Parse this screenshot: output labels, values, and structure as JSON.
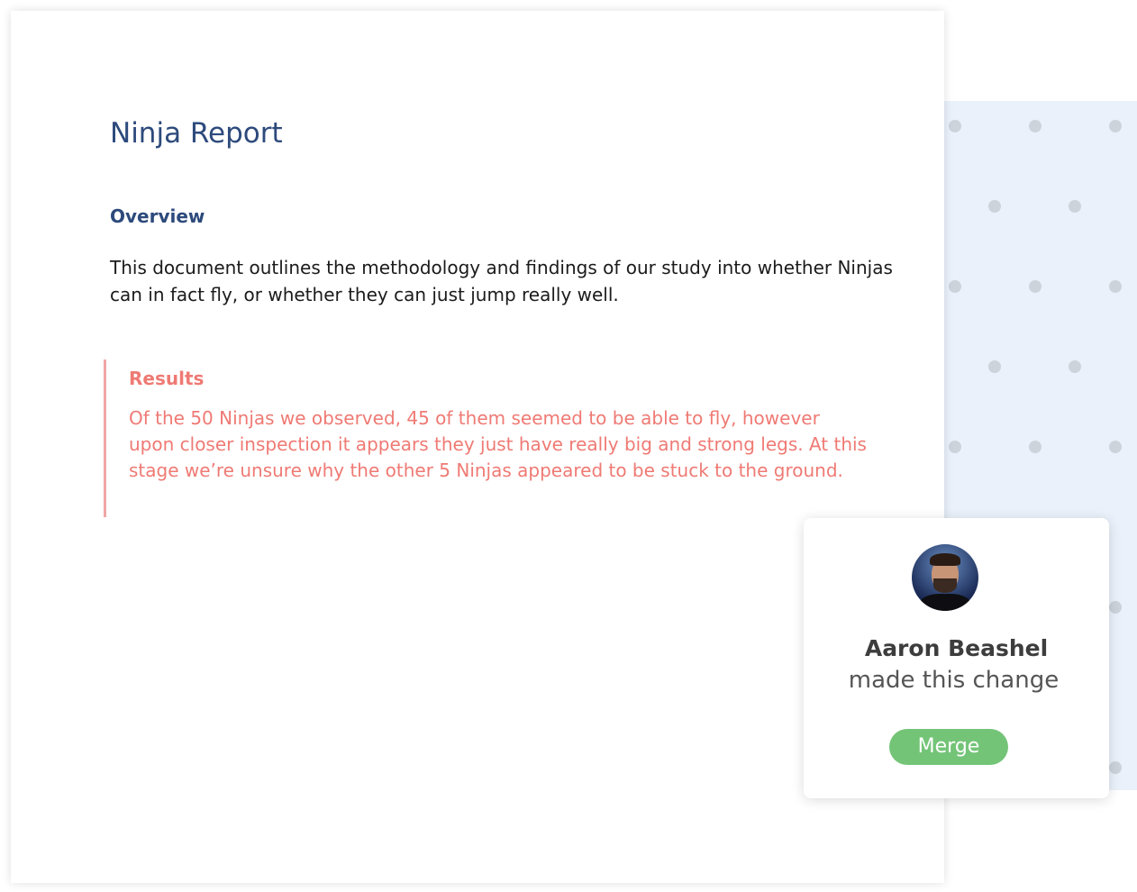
{
  "document": {
    "title": "Ninja Report",
    "overview_heading": "Overview",
    "overview_body": "This document outlines the methodology and findings of our study into whether Ninjas can in fact fly, or whether they can just jump really well.",
    "results_heading": "Results",
    "results_body": "Of the 50 Ninjas we observed, 45 of them seemed to be able to fly, however upon closer inspection it appears they just have really big and strong legs. At this stage we’re unsure why the other 5 Ninjas appeared to be stuck to the ground."
  },
  "change_card": {
    "avatar_icon": "user-avatar",
    "name": "Aaron Beashel",
    "action": "made this change",
    "merge_label": "Merge"
  },
  "colors": {
    "title": "#2d4a7c",
    "change_highlight": "#ef7a74",
    "merge_button": "#74c478",
    "dot_panel": "#eaf1fa"
  }
}
